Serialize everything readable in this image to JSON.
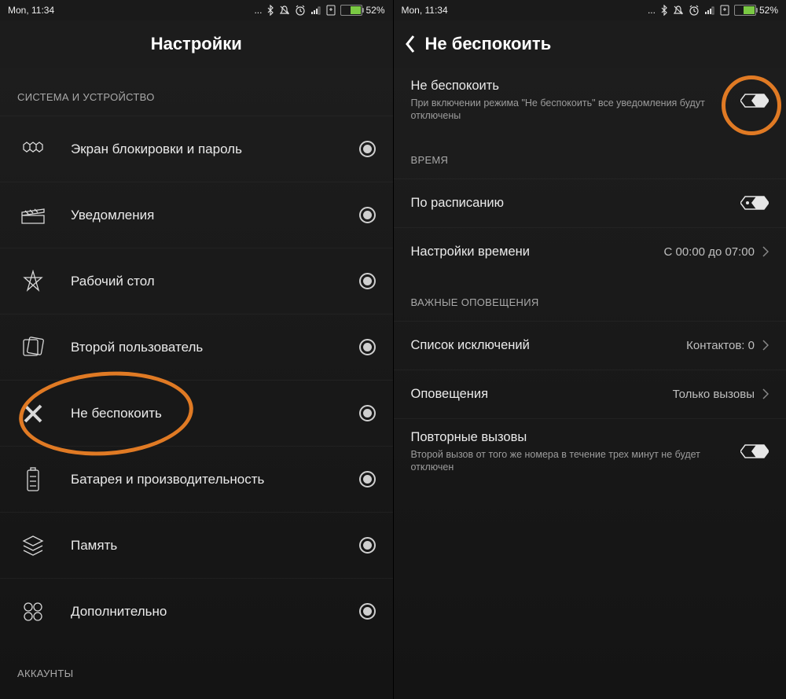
{
  "statusbar": {
    "time": "Mon, 11:34",
    "battery_pct": "52%"
  },
  "left": {
    "title": "Настройки",
    "section1": "СИСТЕМА И УСТРОЙСТВО",
    "section2": "АККАУНТЫ",
    "items": [
      {
        "label": "Экран блокировки и пароль"
      },
      {
        "label": "Уведомления"
      },
      {
        "label": "Рабочий стол"
      },
      {
        "label": "Второй пользователь"
      },
      {
        "label": "Не беспокоить"
      },
      {
        "label": "Батарея и производительность"
      },
      {
        "label": "Память"
      },
      {
        "label": "Дополнительно"
      }
    ]
  },
  "right": {
    "title": "Не беспокоить",
    "dnd": {
      "title": "Не беспокоить",
      "sub": "При включении режима \"Не беспокоить\" все уведомления будут отключены"
    },
    "time_hdr": "ВРЕМЯ",
    "schedule": "По расписанию",
    "time_settings": {
      "label": "Настройки времени",
      "value": "С 00:00 до 07:00"
    },
    "alerts_hdr": "ВАЖНЫЕ ОПОВЕЩЕНИЯ",
    "exceptions": {
      "label": "Список исключений",
      "value": "Контактов: 0"
    },
    "notifications": {
      "label": "Оповещения",
      "value": "Только вызовы"
    },
    "repeat": {
      "title": "Повторные вызовы",
      "sub": "Второй вызов от того же номера в течение трех минут не будет отключен"
    }
  }
}
